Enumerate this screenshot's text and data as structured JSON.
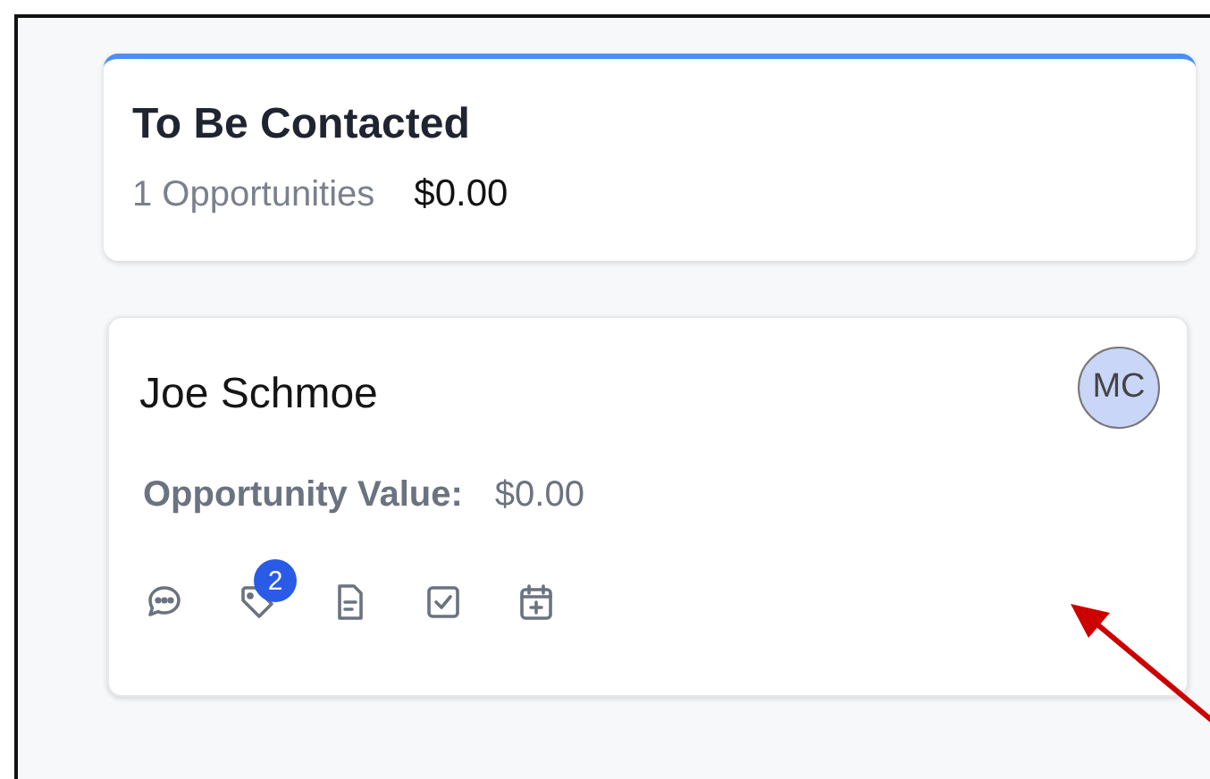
{
  "stage": {
    "title": "To Be Contacted",
    "count": "1 Opportunities",
    "total": "$0.00"
  },
  "opportunity": {
    "name": "Joe Schmoe",
    "avatar": "MC",
    "value_label": "Opportunity Value:",
    "value": "$0.00",
    "actions": [
      {
        "kind": "chat"
      },
      {
        "kind": "tag",
        "badge": "2"
      },
      {
        "kind": "note"
      },
      {
        "kind": "task"
      },
      {
        "kind": "calendar"
      }
    ]
  }
}
